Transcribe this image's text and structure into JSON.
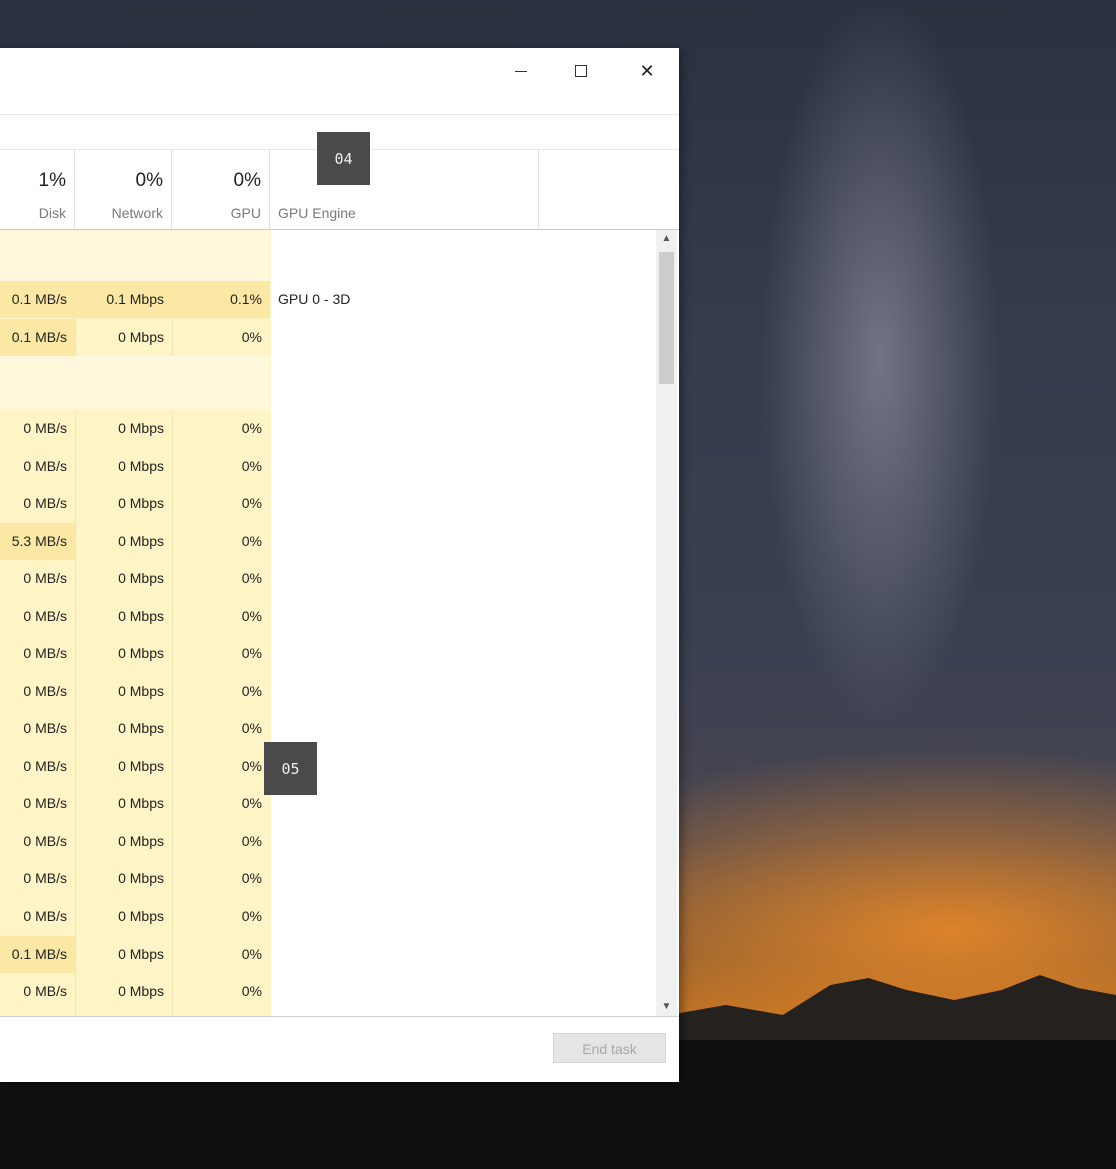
{
  "window": {
    "controls": {
      "close_glyph": "✕"
    }
  },
  "header": {
    "disk": {
      "pct": "1%",
      "label": "Disk"
    },
    "network": {
      "pct": "0%",
      "label": "Network"
    },
    "gpu": {
      "pct": "0%",
      "label": "GPU"
    },
    "gpu_engine": {
      "label": "GPU Engine"
    }
  },
  "rows": [
    {
      "disk": "",
      "network": "",
      "gpu": "",
      "engine": "",
      "group": true
    },
    {
      "disk": "0.1 MB/s",
      "network": "0.1 Mbps",
      "gpu": "0.1%",
      "engine": "GPU 0 - 3D"
    },
    {
      "disk": "0.1 MB/s",
      "network": "0 Mbps",
      "gpu": "0%",
      "engine": ""
    },
    {
      "disk": "",
      "network": "",
      "gpu": "",
      "engine": "",
      "group": true
    },
    {
      "disk": "0 MB/s",
      "network": "0 Mbps",
      "gpu": "0%",
      "engine": ""
    },
    {
      "disk": "0 MB/s",
      "network": "0 Mbps",
      "gpu": "0%",
      "engine": ""
    },
    {
      "disk": "0 MB/s",
      "network": "0 Mbps",
      "gpu": "0%",
      "engine": ""
    },
    {
      "disk": "5.3 MB/s",
      "network": "0 Mbps",
      "gpu": "0%",
      "engine": ""
    },
    {
      "disk": "0 MB/s",
      "network": "0 Mbps",
      "gpu": "0%",
      "engine": ""
    },
    {
      "disk": "0 MB/s",
      "network": "0 Mbps",
      "gpu": "0%",
      "engine": ""
    },
    {
      "disk": "0 MB/s",
      "network": "0 Mbps",
      "gpu": "0%",
      "engine": ""
    },
    {
      "disk": "0 MB/s",
      "network": "0 Mbps",
      "gpu": "0%",
      "engine": ""
    },
    {
      "disk": "0 MB/s",
      "network": "0 Mbps",
      "gpu": "0%",
      "engine": ""
    },
    {
      "disk": "0 MB/s",
      "network": "0 Mbps",
      "gpu": "0%",
      "engine": ""
    },
    {
      "disk": "0 MB/s",
      "network": "0 Mbps",
      "gpu": "0%",
      "engine": ""
    },
    {
      "disk": "0 MB/s",
      "network": "0 Mbps",
      "gpu": "0%",
      "engine": ""
    },
    {
      "disk": "0 MB/s",
      "network": "0 Mbps",
      "gpu": "0%",
      "engine": ""
    },
    {
      "disk": "0 MB/s",
      "network": "0 Mbps",
      "gpu": "0%",
      "engine": ""
    },
    {
      "disk": "0.1 MB/s",
      "network": "0 Mbps",
      "gpu": "0%",
      "engine": ""
    },
    {
      "disk": "0 MB/s",
      "network": "0 Mbps",
      "gpu": "0%",
      "engine": ""
    }
  ],
  "footer": {
    "end_task_label": "End task"
  },
  "callouts": {
    "first": "04",
    "second": "05"
  },
  "colors": {
    "heat_light": "#fff4c6",
    "heat_medium": "#fbe8a4",
    "group_row": "#fff8dc"
  }
}
